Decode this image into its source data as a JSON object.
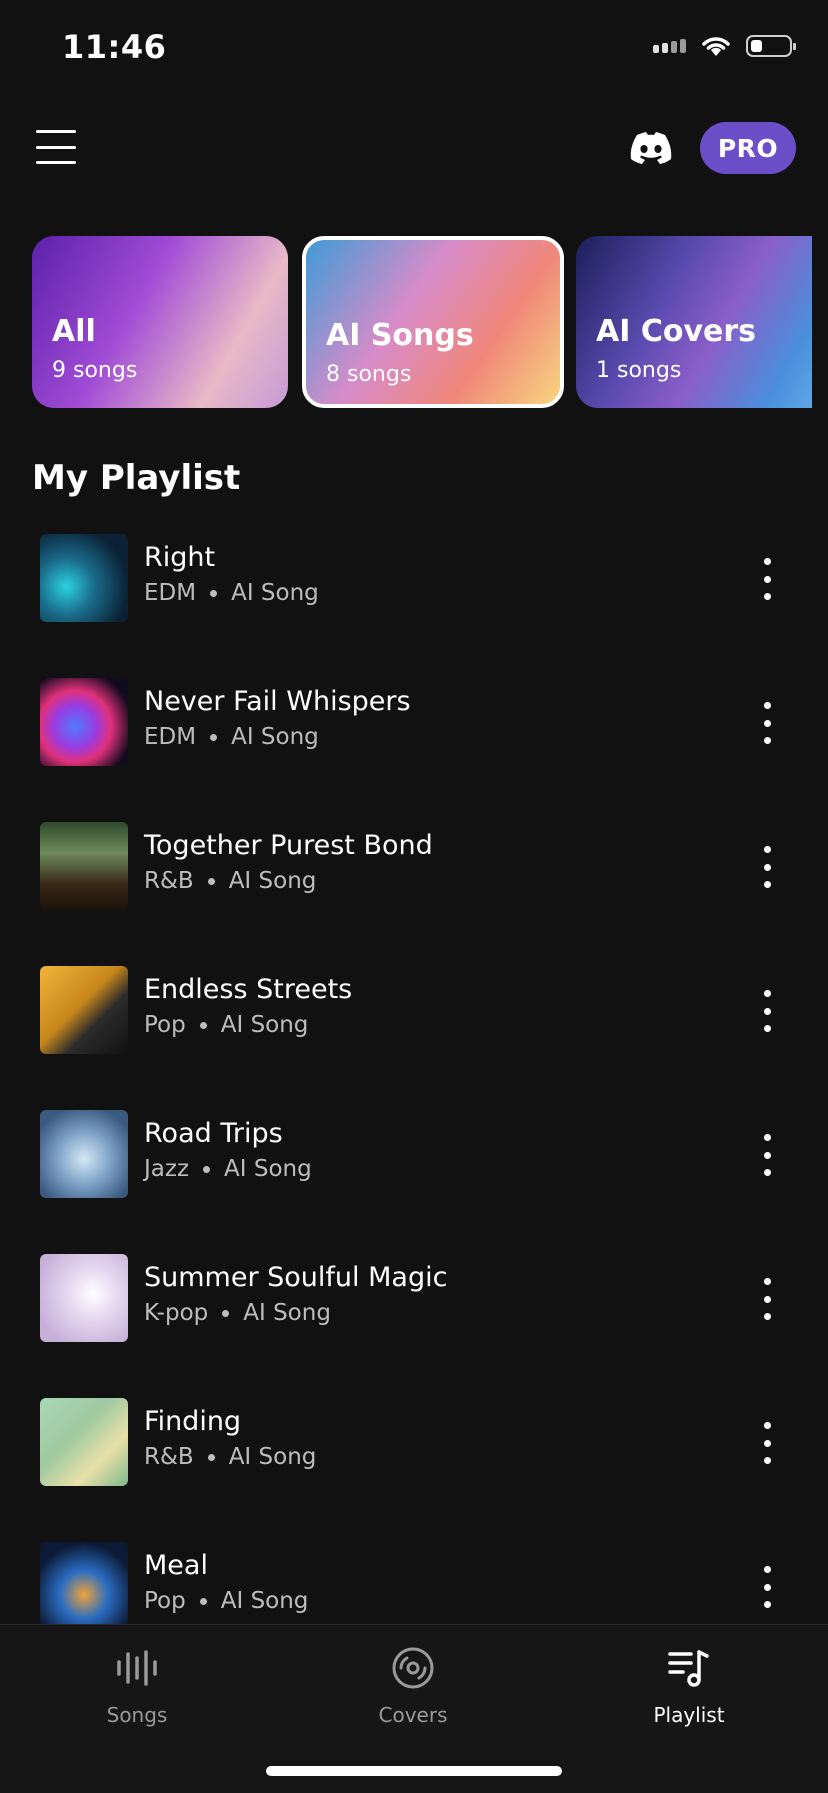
{
  "status_bar": {
    "time": "11:46",
    "battery_level": 0.3
  },
  "header": {
    "pro_label": "PRO"
  },
  "categories": [
    {
      "title": "All",
      "count": "9 songs"
    },
    {
      "title": "AI Songs",
      "count": "8 songs"
    },
    {
      "title": "AI Covers",
      "count": "1 songs"
    }
  ],
  "section_title": "My Playlist",
  "songs": [
    {
      "title": "Right",
      "genre": "EDM",
      "type": "AI Song"
    },
    {
      "title": "Never Fail Whispers",
      "genre": "EDM",
      "type": "AI Song"
    },
    {
      "title": "Together Purest Bond",
      "genre": "R&B",
      "type": "AI Song"
    },
    {
      "title": "Endless Streets",
      "genre": "Pop",
      "type": "AI Song"
    },
    {
      "title": "Road Trips",
      "genre": "Jazz",
      "type": "AI Song"
    },
    {
      "title": "Summer Soulful Magic",
      "genre": "K-pop",
      "type": "AI Song"
    },
    {
      "title": "Finding",
      "genre": "R&B",
      "type": "AI Song"
    },
    {
      "title": "Meal",
      "genre": "Pop",
      "type": "AI Song"
    }
  ],
  "tabs": [
    {
      "label": "Songs",
      "icon": "waveform-icon"
    },
    {
      "label": "Covers",
      "icon": "disc-icon"
    },
    {
      "label": "Playlist",
      "icon": "playlist-icon",
      "active": true
    }
  ],
  "colors": {
    "background": "#111111",
    "pro": "#6a4fc9",
    "muted": "#bdbdbd"
  }
}
